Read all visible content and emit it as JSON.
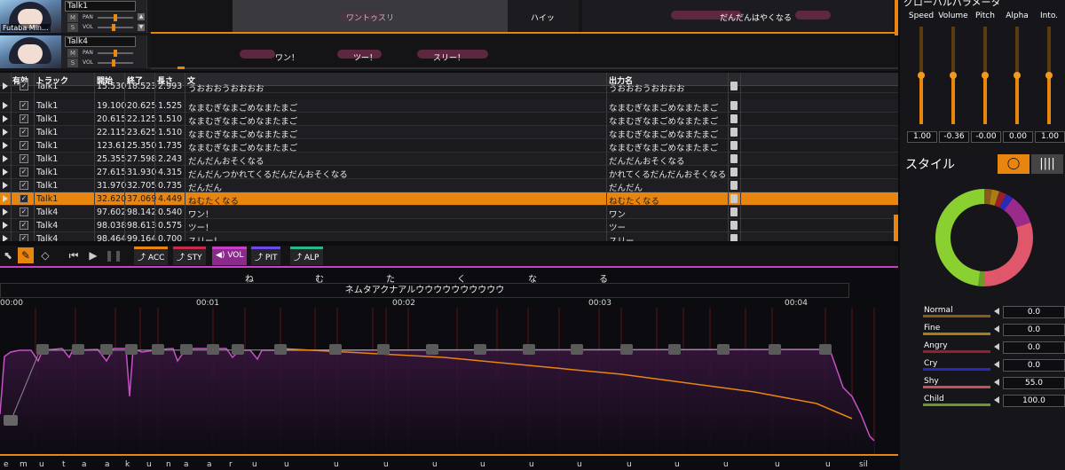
{
  "tracks": [
    {
      "name": "Talk1",
      "avatar_caption": "Futaba Min...",
      "m": "M",
      "s": "S",
      "pan": "PAN",
      "vol": "VOL"
    },
    {
      "name": "Talk4",
      "avatar_caption": "",
      "m": "M",
      "s": "S",
      "pan": "PAN",
      "vol": "VOL"
    }
  ],
  "lane1_clips": [
    "ワントゥスリ",
    "ハイッ",
    "だんだんはやくなる"
  ],
  "lane2_clips": [
    "ワン！",
    "ツー！",
    "スリー！"
  ],
  "table": {
    "headers": {
      "enabled": "有効",
      "track": "トラック",
      "start": "開始",
      "end": "終了",
      "length": "長さ",
      "text": "文",
      "output": "出力名"
    },
    "rows": [
      {
        "track": "Talk1",
        "start": "15.530",
        "end": "18.523",
        "len": "2.993",
        "text": "うおおおうおおおお",
        "out": "うおおおうおおおお"
      },
      {
        "track": "Talk1",
        "start": "19.100",
        "end": "20.625",
        "len": "1.525",
        "text": "なまむぎなまごめなまたまご",
        "out": "なまむぎなまごめなまたまご"
      },
      {
        "track": "Talk1",
        "start": "20.615",
        "end": "22.125",
        "len": "1.510",
        "text": "なまむぎなまごめなまたまご",
        "out": "なまむぎなまごめなまたまご"
      },
      {
        "track": "Talk1",
        "start": "22.115",
        "end": "23.625",
        "len": "1.510",
        "text": "なまむぎなまごめなまたまご",
        "out": "なまむぎなまごめなまたまご"
      },
      {
        "track": "Talk1",
        "start": "123.61",
        "end": "25.350",
        "len": "1.735",
        "text": "なまむぎなまごめなまたまご",
        "out": "なまむぎなまごめなまたまご"
      },
      {
        "track": "Talk1",
        "start": "25.355",
        "end": "27.598",
        "len": "2.243",
        "text": "だんだんおそくなる",
        "out": "だんだんおそくなる"
      },
      {
        "track": "Talk1",
        "start": "27.615",
        "end": "31.930",
        "len": "4.315",
        "text": "だんだんつかれてくるだんだんおそくなる",
        "out": "かれてくるだんだんおそくなる"
      },
      {
        "track": "Talk1",
        "start": "31.970",
        "end": "32.705",
        "len": "0.735",
        "text": "だんだん",
        "out": "だんだん"
      },
      {
        "track": "Talk1",
        "start": "32.620",
        "end": "37.069",
        "len": "4.449",
        "text": "ねむたくなる",
        "out": "ねむたくなる",
        "selected": true
      },
      {
        "track": "Talk4",
        "start": "97.602",
        "end": "98.142",
        "len": "0.540",
        "text": "ワン！",
        "out": "ワン"
      },
      {
        "track": "Talk4",
        "start": "98.038",
        "end": "98.613",
        "len": "0.575",
        "text": "ツー！",
        "out": "ツー"
      },
      {
        "track": "Talk4",
        "start": "98.464",
        "end": "99.164",
        "len": "0.700",
        "text": "スリー！",
        "out": "スリー"
      }
    ]
  },
  "modes": [
    {
      "label": "ACC",
      "color": "#e8850f"
    },
    {
      "label": "STY",
      "color": "#c82a4a"
    },
    {
      "label": "VOL",
      "color": "#c840c8"
    },
    {
      "label": "PIT",
      "color": "#6a4ae8"
    },
    {
      "label": "ALP",
      "color": "#2ab88a"
    }
  ],
  "editor": {
    "kana": [
      "ね",
      "む",
      "た",
      "く",
      "な",
      "る"
    ],
    "phrase": "ネムタアクナアルウウウウウウウウウウ",
    "ticks": [
      "00:00",
      "00:01",
      "00:02",
      "00:03",
      "00:04"
    ],
    "phonemes": [
      "e",
      "m",
      "u",
      "t",
      "a",
      "a",
      "k",
      "u",
      "n",
      "a",
      "a",
      "r",
      "u",
      "u",
      "u",
      "u",
      "u",
      "u",
      "u",
      "u",
      "u",
      "u",
      "u",
      "u",
      "u",
      "sil"
    ]
  },
  "right": {
    "title": "グローバルパラメータ",
    "sliders": [
      {
        "label": "Speed",
        "value": "1.00",
        "level": 0.5
      },
      {
        "label": "Volume",
        "value": "-0.36",
        "level": 0.5
      },
      {
        "label": "Pitch",
        "value": "-0.00",
        "level": 0.5
      },
      {
        "label": "Alpha",
        "value": "0.00",
        "level": 0.5
      },
      {
        "label": "Into.",
        "value": "1.00",
        "level": 0.5
      }
    ],
    "style_title": "スタイル",
    "emotions": [
      {
        "label": "Normal",
        "value": "0.0",
        "color": "#8a5a1a"
      },
      {
        "label": "Fine",
        "value": "0.0",
        "color": "#a87f10"
      },
      {
        "label": "Angry",
        "value": "0.0",
        "color": "#9a1f2a"
      },
      {
        "label": "Cry",
        "value": "0.0",
        "color": "#2a2ab8"
      },
      {
        "label": "Shy",
        "value": "55.0",
        "color": "#c8505a"
      },
      {
        "label": "Child",
        "value": "100.0",
        "color": "#6a9a2a"
      }
    ]
  }
}
